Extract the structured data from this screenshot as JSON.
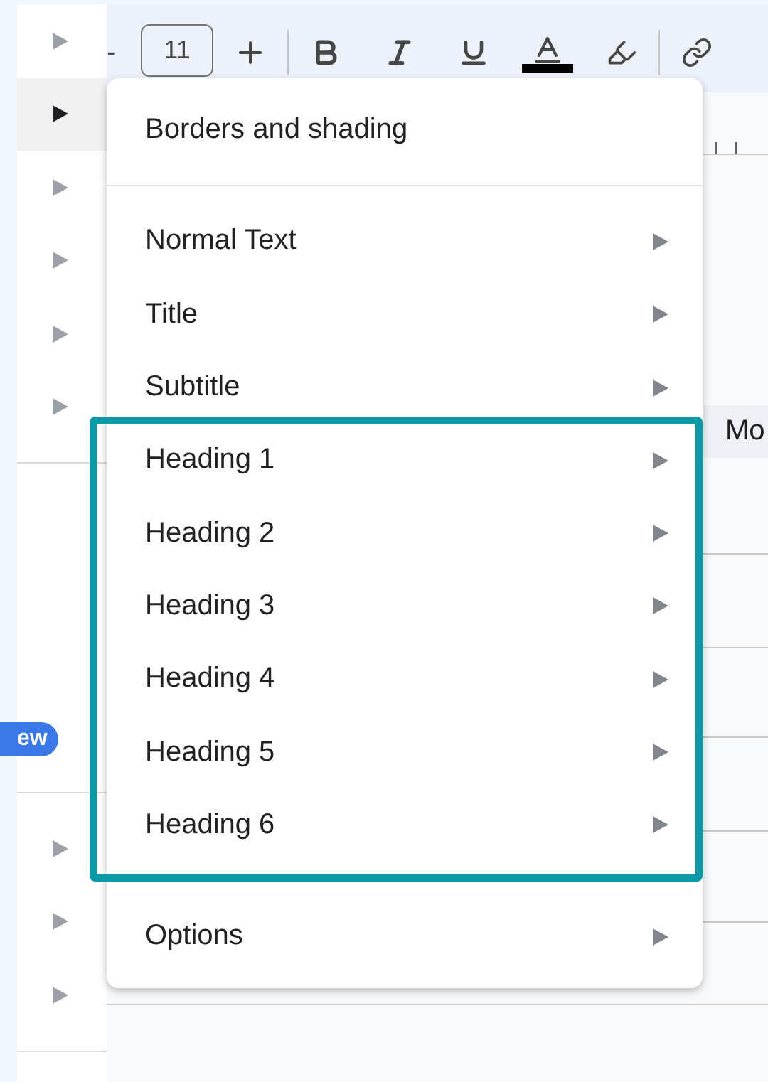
{
  "left_panel": {
    "rows_top": [
      {
        "selected": false
      },
      {
        "selected": true
      },
      {
        "selected": false
      },
      {
        "selected": false
      },
      {
        "selected": false
      },
      {
        "selected": false
      }
    ],
    "badge": "ew",
    "rows_bottom": [
      {
        "selected": false
      },
      {
        "selected": false
      },
      {
        "selected": false
      }
    ]
  },
  "toolbar": {
    "minus": "-",
    "font_size": "11"
  },
  "document": {
    "side_text": "Mo"
  },
  "menu": {
    "sections": [
      {
        "divider_after": true,
        "highlighted": false,
        "items": [
          {
            "label": "Borders and shading",
            "submenu": false
          }
        ]
      },
      {
        "divider_after": false,
        "highlighted": false,
        "items": [
          {
            "label": "Normal Text",
            "submenu": true
          },
          {
            "label": "Title",
            "submenu": true
          },
          {
            "label": "Subtitle",
            "submenu": true
          }
        ]
      },
      {
        "divider_after": false,
        "highlighted": true,
        "items": [
          {
            "label": "Heading 1",
            "submenu": true
          },
          {
            "label": "Heading 2",
            "submenu": true
          },
          {
            "label": "Heading 3",
            "submenu": true
          },
          {
            "label": "Heading 4",
            "submenu": true
          },
          {
            "label": "Heading 5",
            "submenu": true
          },
          {
            "label": "Heading 6",
            "submenu": true
          }
        ]
      },
      {
        "divider_after": false,
        "highlighted": false,
        "items": [
          {
            "label": "Options",
            "submenu": true
          }
        ]
      }
    ]
  }
}
